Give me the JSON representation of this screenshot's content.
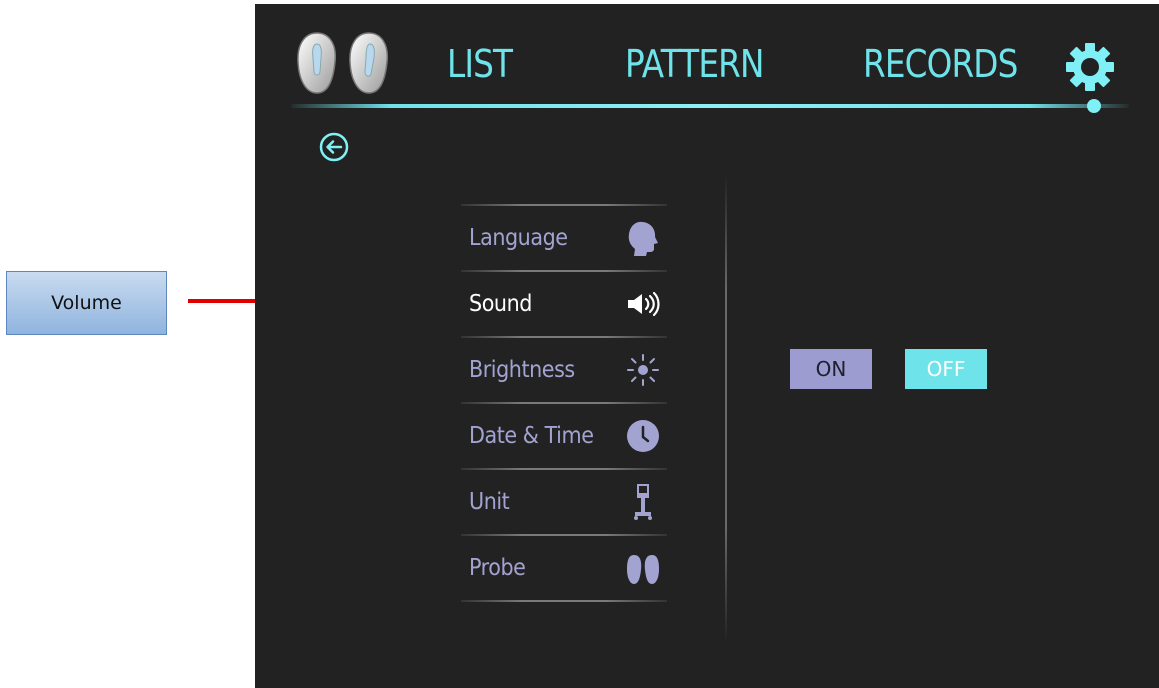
{
  "annotation": {
    "label": "Volume"
  },
  "header": {
    "nav": [
      {
        "label": "LIST"
      },
      {
        "label": "PATTERN"
      },
      {
        "label": "RECORDS"
      }
    ]
  },
  "settings_menu": [
    {
      "label": "Language",
      "icon": "head-profile-icon"
    },
    {
      "label": "Sound",
      "icon": "speaker-icon",
      "active": true
    },
    {
      "label": "Brightness",
      "icon": "sun-icon"
    },
    {
      "label": "Date & Time",
      "icon": "clock-icon"
    },
    {
      "label": "Unit",
      "icon": "unit-stand-icon"
    },
    {
      "label": "Probe",
      "icon": "probe-icon"
    }
  ],
  "toggle": {
    "on_label": "ON",
    "off_label": "OFF",
    "selected": "OFF"
  },
  "colors": {
    "accent": "#6fe3ea",
    "menu_text": "#a3a3d2",
    "background": "#222222",
    "callout_line": "#e00000"
  }
}
